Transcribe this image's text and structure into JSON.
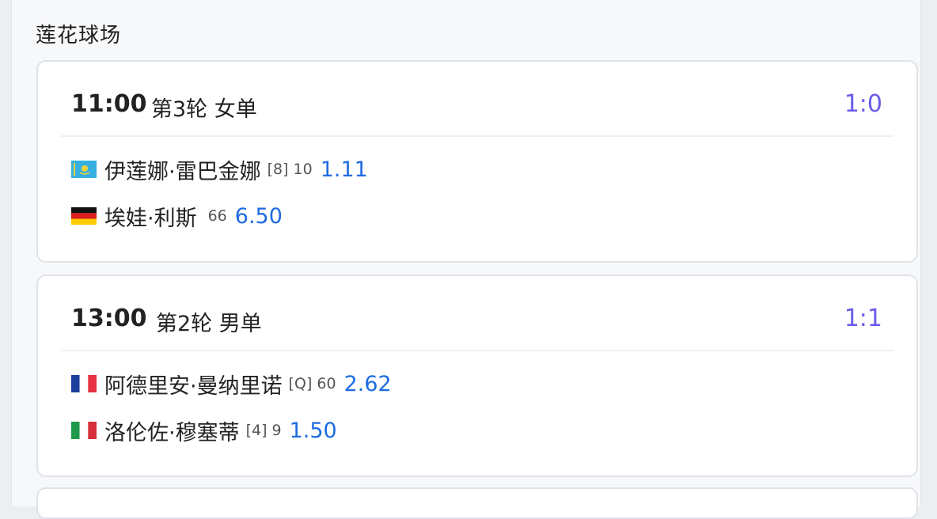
{
  "venue": "莲花球场",
  "matches": [
    {
      "time": "11:00",
      "round": "第3轮 女单",
      "score": "1:0",
      "players": [
        {
          "flag": "kazakhstan-flag-icon",
          "name": "伊莲娜·雷巴金娜",
          "seed": "[8]",
          "rank": "10",
          "odds": "1.11"
        },
        {
          "flag": "germany-flag-icon",
          "name": "埃娃·利斯",
          "seed": "",
          "rank": "66",
          "odds": "6.50"
        }
      ]
    },
    {
      "time": "13:00",
      "round": "第2轮 男单",
      "score": "1:1",
      "players": [
        {
          "flag": "france-flag-icon",
          "name": "阿德里安·曼纳里诺",
          "seed": "[Q]",
          "rank": "60",
          "odds": "2.62"
        },
        {
          "flag": "italy-flag-icon",
          "name": "洛伦佐·穆塞蒂",
          "seed": "[4]",
          "rank": "9",
          "odds": "1.50"
        }
      ]
    }
  ],
  "colors": {
    "score": "#6a5ce8",
    "odds": "#1e6be0",
    "card_border": "#dfe3e8",
    "background": "#eceef1"
  }
}
